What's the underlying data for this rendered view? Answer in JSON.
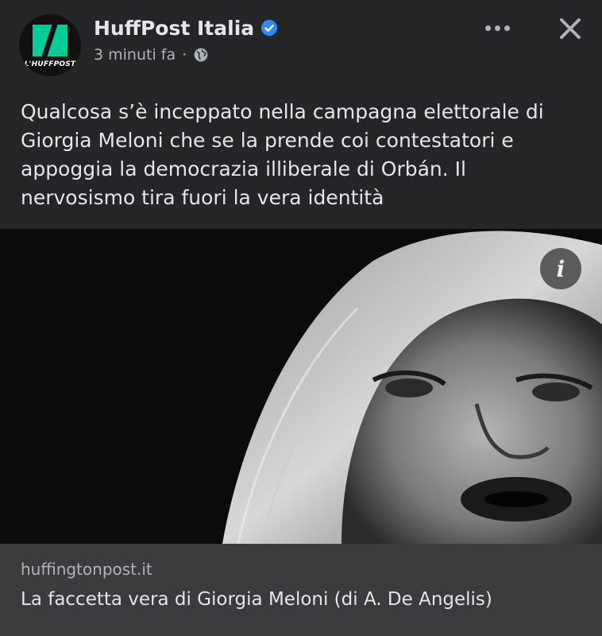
{
  "header": {
    "page_name": "HuffPost Italia",
    "timestamp": "3 minuti fa",
    "separator": "·",
    "avatar_text": "L'HUFFPOST",
    "icons": {
      "verified": "verified-badge-icon",
      "audience": "globe-icon",
      "more": "more-options-icon",
      "close": "close-icon"
    }
  },
  "post": {
    "text": "Qualcosa s’è inceppato nella campagna elettorale di Giorgia Meloni che se la prende coi contestatori e appoggia la democrazia illiberale di Orbán. Il nervosismo tira fuori la vera identità"
  },
  "image": {
    "info_label": "i"
  },
  "link_preview": {
    "domain": "huffingtonpost.it",
    "title": "La faccetta vera di Giorgia Meloni (di A. De Angelis)"
  },
  "colors": {
    "background": "#242526",
    "link_bar": "#3a3b3c",
    "verified": "#2d88ff",
    "brand_green": "#00cc99"
  }
}
